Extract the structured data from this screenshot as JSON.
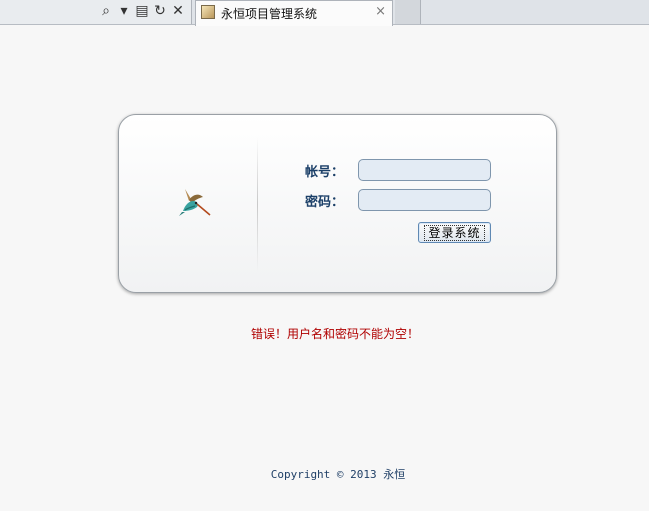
{
  "browser": {
    "tab_title": "永恒项目管理系统",
    "tab_close": "×",
    "icons": {
      "search": "⌕",
      "dropdown": "▾",
      "compat": "▤",
      "refresh": "↻",
      "stop": "✕"
    }
  },
  "login": {
    "username_label": "帐号：",
    "password_label": "密码：",
    "username_value": "",
    "password_value": "",
    "submit_label": "登录系统",
    "logo_icon": "hummingbird-icon"
  },
  "error": {
    "message": "错误！用户名和密码不能为空！"
  },
  "footer": {
    "copyright": "Copyright © 2013 永恒"
  },
  "colors": {
    "error": "#b00000",
    "label": "#1b3f68",
    "input_bg": "#e3ebf4"
  }
}
